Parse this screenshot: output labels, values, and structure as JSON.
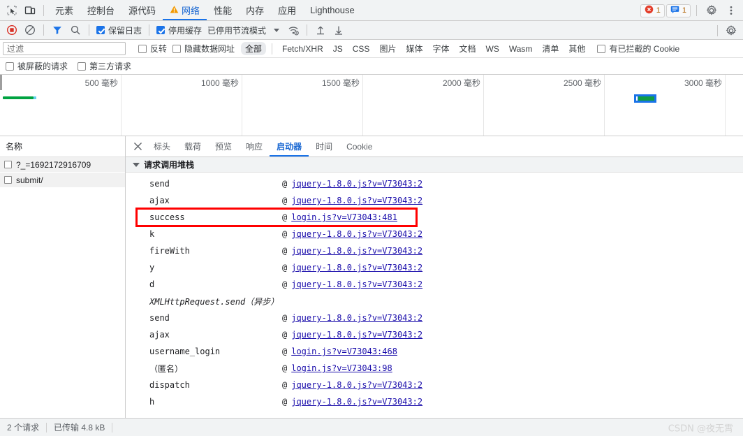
{
  "tabbar": {
    "icons": [
      {
        "name": "inspect-element-icon"
      },
      {
        "name": "device-toolbar-icon"
      }
    ],
    "tabs": [
      {
        "label": "元素",
        "active": false,
        "warn": false
      },
      {
        "label": "控制台",
        "active": false,
        "warn": false
      },
      {
        "label": "源代码",
        "active": false,
        "warn": false
      },
      {
        "label": "网络",
        "active": true,
        "warn": true
      },
      {
        "label": "性能",
        "active": false,
        "warn": false
      },
      {
        "label": "内存",
        "active": false,
        "warn": false
      },
      {
        "label": "应用",
        "active": false,
        "warn": false
      },
      {
        "label": "Lighthouse",
        "active": false,
        "warn": false
      }
    ],
    "error_badge": {
      "count": "1",
      "icon": "error-circle-icon"
    },
    "message_badge": {
      "count": "1",
      "icon": "message-icon"
    },
    "settings_label": "gear-icon",
    "more_label": "kebab-menu-icon"
  },
  "nettoolbar": {
    "record_icon": "record-stop-icon",
    "clear_icon": "clear-no-entry-icon",
    "filter_icon": "funnel-filter-icon",
    "search_icon": "search-icon",
    "preserve_log": {
      "label": "保留日志",
      "checked": true
    },
    "disable_cache": {
      "label": "停用缓存",
      "checked": true
    },
    "throttling": "已停用节流模式",
    "wifi_icon": "network-conditions-icon",
    "import_icon": "import-har-icon",
    "export_icon": "export-har-icon",
    "settings_icon": "network-settings-gear-icon"
  },
  "filterbar": {
    "placeholder": "过滤",
    "value": "",
    "invert": {
      "label": "反转",
      "checked": false
    },
    "hide_data_urls": {
      "label": "隐藏数据网址",
      "checked": false
    },
    "types": [
      {
        "label": "全部",
        "active": true
      },
      {
        "label": "Fetch/XHR",
        "active": false
      },
      {
        "label": "JS",
        "active": false
      },
      {
        "label": "CSS",
        "active": false
      },
      {
        "label": "图片",
        "active": false
      },
      {
        "label": "媒体",
        "active": false
      },
      {
        "label": "字体",
        "active": false
      },
      {
        "label": "文档",
        "active": false
      },
      {
        "label": "WS",
        "active": false
      },
      {
        "label": "Wasm",
        "active": false
      },
      {
        "label": "清单",
        "active": false
      },
      {
        "label": "其他",
        "active": false
      }
    ],
    "blocked_cookies": {
      "label": "有已拦截的 Cookie",
      "checked": false
    },
    "blocked_requests": {
      "label": "被屏蔽的请求",
      "checked": false
    },
    "third_party": {
      "label": "第三方请求",
      "checked": false
    }
  },
  "overview": {
    "ticks": [
      "500 毫秒",
      "1000 毫秒",
      "1500 毫秒",
      "2000 毫秒",
      "2500 毫秒",
      "3000 毫秒"
    ],
    "bars": [
      {
        "name": "request-bar-1",
        "selected": false,
        "color": "#00a341"
      },
      {
        "name": "request-bar-2",
        "selected": true,
        "color": "#0f9d43"
      }
    ],
    "selection_color": "#1a73e8"
  },
  "requests": {
    "header": "名称",
    "rows": [
      {
        "name": "?_=1692172916709",
        "selected": false
      },
      {
        "name": "submit/",
        "selected": true
      }
    ]
  },
  "detail": {
    "close_icon": "close-icon",
    "tabs": [
      {
        "label": "标头",
        "active": false
      },
      {
        "label": "载荷",
        "active": false
      },
      {
        "label": "预览",
        "active": false
      },
      {
        "label": "响应",
        "active": false
      },
      {
        "label": "启动器",
        "active": true
      },
      {
        "label": "时间",
        "active": false
      },
      {
        "label": "Cookie",
        "active": false
      }
    ],
    "section_title": "请求调用堆栈",
    "at_symbol": "@",
    "stack": [
      {
        "fn": "send",
        "src": "jquery-1.8.0.js?v=V73043:2",
        "async": false,
        "highlight": false,
        "link": true
      },
      {
        "fn": "ajax",
        "src": "jquery-1.8.0.js?v=V73043:2",
        "async": false,
        "highlight": false,
        "link": true
      },
      {
        "fn": "success",
        "src": "login.js?v=V73043:481",
        "async": false,
        "highlight": true,
        "link": true
      },
      {
        "fn": "k",
        "src": "jquery-1.8.0.js?v=V73043:2",
        "async": false,
        "highlight": false,
        "link": true
      },
      {
        "fn": "fireWith",
        "src": "jquery-1.8.0.js?v=V73043:2",
        "async": false,
        "highlight": false,
        "link": true
      },
      {
        "fn": "y",
        "src": "jquery-1.8.0.js?v=V73043:2",
        "async": false,
        "highlight": false,
        "link": true
      },
      {
        "fn": "d",
        "src": "jquery-1.8.0.js?v=V73043:2",
        "async": false,
        "highlight": false,
        "link": true
      },
      {
        "fn": "XMLHttpRequest.send（异步）",
        "src": "",
        "async": true,
        "highlight": false,
        "link": false
      },
      {
        "fn": "send",
        "src": "jquery-1.8.0.js?v=V73043:2",
        "async": false,
        "highlight": false,
        "link": true
      },
      {
        "fn": "ajax",
        "src": "jquery-1.8.0.js?v=V73043:2",
        "async": false,
        "highlight": false,
        "link": true
      },
      {
        "fn": "username_login",
        "src": "login.js?v=V73043:468",
        "async": false,
        "highlight": false,
        "link": true
      },
      {
        "fn": "（匿名）",
        "src": "login.js?v=V73043:98",
        "async": false,
        "highlight": false,
        "link": true
      },
      {
        "fn": "dispatch",
        "src": "jquery-1.8.0.js?v=V73043:2",
        "async": false,
        "highlight": false,
        "link": true
      },
      {
        "fn": "h",
        "src": "jquery-1.8.0.js?v=V73043:2",
        "async": false,
        "highlight": false,
        "link": true
      }
    ]
  },
  "statusbar": {
    "requests": "2 个请求",
    "transferred": "已传输 4.8 kB",
    "watermark": "CSDN @夜无霄"
  }
}
